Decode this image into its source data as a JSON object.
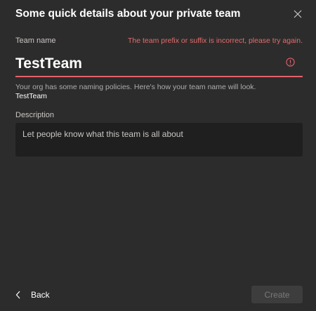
{
  "dialog": {
    "title": "Some quick details about your private team",
    "close_icon": "close-icon"
  },
  "team_name": {
    "label": "Team name",
    "error_message": "The team prefix or suffix is incorrect, please try again.",
    "value": "TestTeam",
    "error_icon": "error-circle-icon",
    "error_color": "#e2616b"
  },
  "naming_policy": {
    "note": "Your org has some naming policies. Here's how your team name will look.",
    "preview": "TestTeam"
  },
  "description": {
    "label": "Description",
    "placeholder": "Let people know what this team is all about"
  },
  "footer": {
    "back_label": "Back",
    "back_icon": "chevron-left-icon",
    "create_label": "Create"
  }
}
